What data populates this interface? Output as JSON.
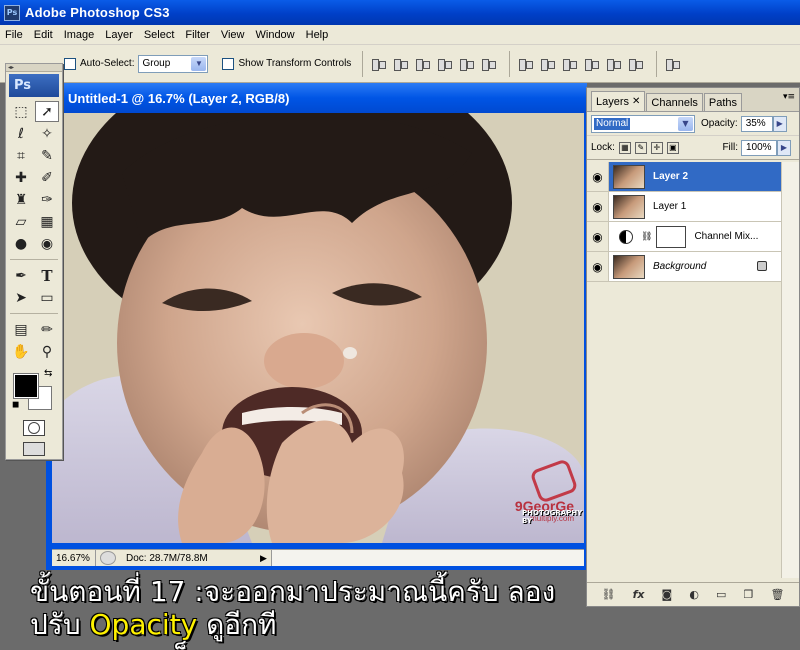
{
  "app": {
    "title": "Adobe Photoshop CS3",
    "icon_label": "Ps"
  },
  "menu": [
    "File",
    "Edit",
    "Image",
    "Layer",
    "Select",
    "Filter",
    "View",
    "Window",
    "Help"
  ],
  "options": {
    "auto_select_label": "Auto-Select:",
    "auto_select_value": "Group",
    "transform_label": "Show Transform Controls"
  },
  "toolbox": {
    "logo": "Ps"
  },
  "document": {
    "title": "Untitled-1 @ 16.7% (Layer 2, RGB/8)",
    "zoom": "16.67%",
    "doc_info": "Doc: 28.7M/78.8M",
    "watermark": {
      "brand": "9GeorGe",
      "site": "multiply.com",
      "credit": "PHOTOGRAPHY BY"
    }
  },
  "layers_panel": {
    "tabs": [
      "Layers",
      "Channels",
      "Paths"
    ],
    "blend_mode": "Normal",
    "opacity_label": "Opacity:",
    "opacity_value": "35%",
    "lock_label": "Lock:",
    "fill_label": "Fill:",
    "fill_value": "100%",
    "layers": [
      {
        "name": "Layer 2",
        "selected": true
      },
      {
        "name": "Layer 1",
        "selected": false
      },
      {
        "name": "Channel Mix...",
        "selected": false
      },
      {
        "name": "Background",
        "selected": false
      }
    ]
  },
  "caption": {
    "line1_before": "ขั้นตอนที่ 17 :จะออกมาประมาณนี้ครับ ลองปรับ ",
    "line1_highlight": "Opacity",
    "line1_after": " ดูอีกที",
    "line2": "จนเหมาะเหม็ง"
  },
  "colors": {
    "title_bar": "#0a5ce8",
    "selected_layer": "#316ac5",
    "caption_highlight": "#fff200",
    "foreground": "#000000",
    "background": "#ffffff"
  }
}
